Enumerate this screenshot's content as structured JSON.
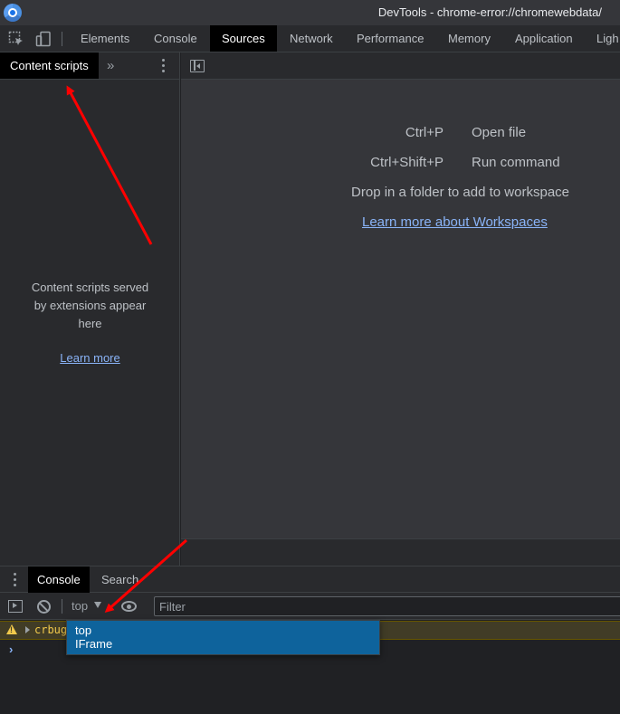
{
  "window": {
    "title": "DevTools - chrome-error://chromewebdata/"
  },
  "main_tabs": [
    {
      "label": "Elements",
      "active": false
    },
    {
      "label": "Console",
      "active": false
    },
    {
      "label": "Sources",
      "active": true
    },
    {
      "label": "Network",
      "active": false
    },
    {
      "label": "Performance",
      "active": false
    },
    {
      "label": "Memory",
      "active": false
    },
    {
      "label": "Application",
      "active": false
    },
    {
      "label": "Ligh",
      "active": false
    }
  ],
  "sidebar": {
    "active_tab": "Content scripts",
    "more_label": "»",
    "empty_line1": "Content scripts served",
    "empty_line2": "by extensions appear",
    "empty_line3": "here",
    "learn_more": "Learn more"
  },
  "editor": {
    "shortcuts": [
      {
        "key": "Ctrl+P",
        "label": "Open file"
      },
      {
        "key": "Ctrl+Shift+P",
        "label": "Run command"
      }
    ],
    "drop_text": "Drop in a folder to add to workspace",
    "workspaces_link": "Learn more about Workspaces"
  },
  "drawer": {
    "tabs": [
      {
        "label": "Console",
        "active": true
      },
      {
        "label": "Search",
        "active": false
      }
    ]
  },
  "console": {
    "context": "top",
    "filter_placeholder": "Filter",
    "warning_text": "crbug",
    "prompt": "›",
    "context_options": [
      "top",
      "IFrame"
    ]
  },
  "colors": {
    "accent": "#8ab4f8",
    "selection": "#0e639c",
    "annotation_arrow": "#ff0000",
    "warning": "#f2c94c"
  }
}
